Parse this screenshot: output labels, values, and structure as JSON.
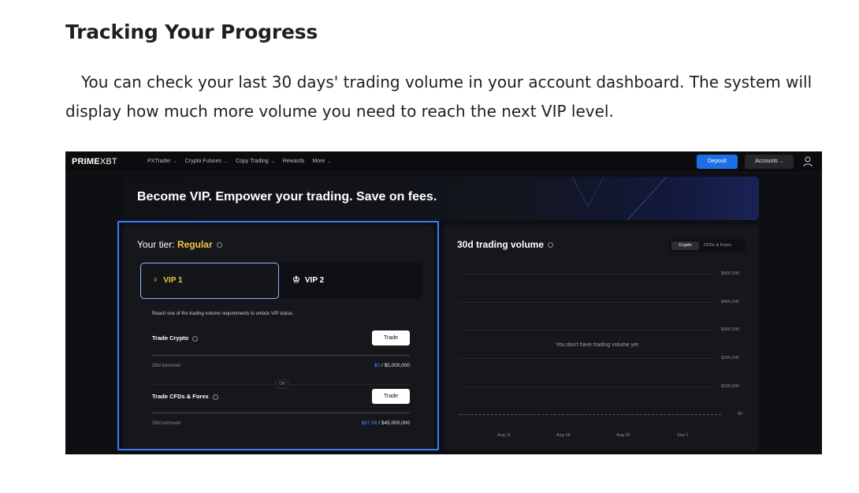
{
  "article": {
    "title": "Tracking Your Progress",
    "body": "You can check your last 30 days' trading volume in your account dashboard. The system will display how much more volume you need to reach the next VIP level."
  },
  "nav": {
    "logo_bold": "PRIME",
    "logo_thin": "XBT",
    "links": [
      {
        "label": "PXTrader",
        "dropdown": true
      },
      {
        "label": "Crypto Futures",
        "dropdown": true
      },
      {
        "label": "Copy Trading",
        "dropdown": true
      },
      {
        "label": "Rewards",
        "dropdown": false
      },
      {
        "label": "More",
        "dropdown": true
      }
    ],
    "deposit_label": "Deposit",
    "accounts_label": "Accounts",
    "user_icon": "user-icon"
  },
  "banner": {
    "title": "Become VIP. Empower your trading. Save on fees."
  },
  "tier": {
    "prefix": "Your tier:",
    "value": "Regular",
    "tabs": {
      "vip1": "VIP 1",
      "vip2": "VIP 2"
    },
    "requirement_text": "Reach one of the trading volume requirements to unlock VIP status.",
    "crypto": {
      "label": "Trade Crypto",
      "button": "Trade",
      "turnover_label": "30d turnover",
      "current": "$0",
      "target": "/ $5,000,000",
      "progress": 0
    },
    "or_label": "OR",
    "cfds": {
      "label": "Trade CFDs & Forex",
      "button": "Trade",
      "turnover_label": "30d turnover",
      "current": "$67.98",
      "target": "/ $45,000,000",
      "progress": 1.5e-06
    }
  },
  "volume": {
    "title": "30d trading volume",
    "toggle": {
      "active": "Crypto",
      "inactive": "CFDs & Forex"
    },
    "empty_message": "You don't have trading volume yet",
    "chart_data": {
      "type": "line",
      "title": "30d trading volume",
      "y_ticks": [
        "$500,000",
        "$400,000",
        "$300,000",
        "$200,000",
        "$100,000",
        "$0"
      ],
      "x_ticks": [
        "Aug 11",
        "Aug 18",
        "Aug 25",
        "Sep 1"
      ],
      "ylim": [
        0,
        500000
      ],
      "series": []
    }
  },
  "colors": {
    "accent_blue": "#1d6fe6",
    "gold": "#f4c542",
    "highlight": "#3f7bff"
  }
}
